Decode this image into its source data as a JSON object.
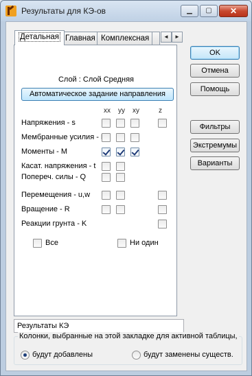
{
  "window": {
    "title": "Результаты для КЭ-ов",
    "minimize_glyph": "▁",
    "maximize_glyph": "▢",
    "close_glyph": "✕"
  },
  "tabs": [
    {
      "label": "Детальная",
      "active": true
    },
    {
      "label": "Главная",
      "active": false
    },
    {
      "label": "Комплексная",
      "active": false
    }
  ],
  "tab_scroll": {
    "left": "◄",
    "right": "►"
  },
  "panel": {
    "layer_label": "Слой : Слой Средняя",
    "auto_button": "Автоматическое задание направления",
    "columns": [
      "xx",
      "yy",
      "xy",
      "z"
    ],
    "rows": [
      {
        "label": "Напряжения - s",
        "checks": [
          false,
          false,
          false,
          false
        ]
      },
      {
        "label": "Мембранные усилия - N",
        "checks": [
          false,
          false,
          false,
          null
        ]
      },
      {
        "label": "Моменты - M",
        "checks": [
          true,
          true,
          true,
          null
        ]
      },
      {
        "label": "Касат. напряжения - t",
        "checks": [
          false,
          false,
          null,
          null
        ]
      },
      {
        "label": "Попереч. силы - Q",
        "checks": [
          false,
          false,
          null,
          null
        ]
      },
      {
        "label": "Перемещения - u,w",
        "checks": [
          false,
          false,
          null,
          false
        ]
      },
      {
        "label": "Вращение - R",
        "checks": [
          false,
          false,
          null,
          false
        ]
      },
      {
        "label": "Реакции грунта - K",
        "checks": [
          null,
          null,
          null,
          false
        ]
      }
    ],
    "all_label": "Все",
    "none_label": "Ни один"
  },
  "buttons": {
    "ok": "OK",
    "cancel": "Отмена",
    "help": "Помощь",
    "filters": "Фильтры",
    "extremes": "Экстремумы",
    "variants": "Варианты"
  },
  "result_field": {
    "value": "Результаты КЭ"
  },
  "columns_group": {
    "title": "Колонки, выбранные на этой закладке для активной таблицы,",
    "option_add": "будут добавлены",
    "option_replace": "будут заменены существ.",
    "selected": "add"
  }
}
